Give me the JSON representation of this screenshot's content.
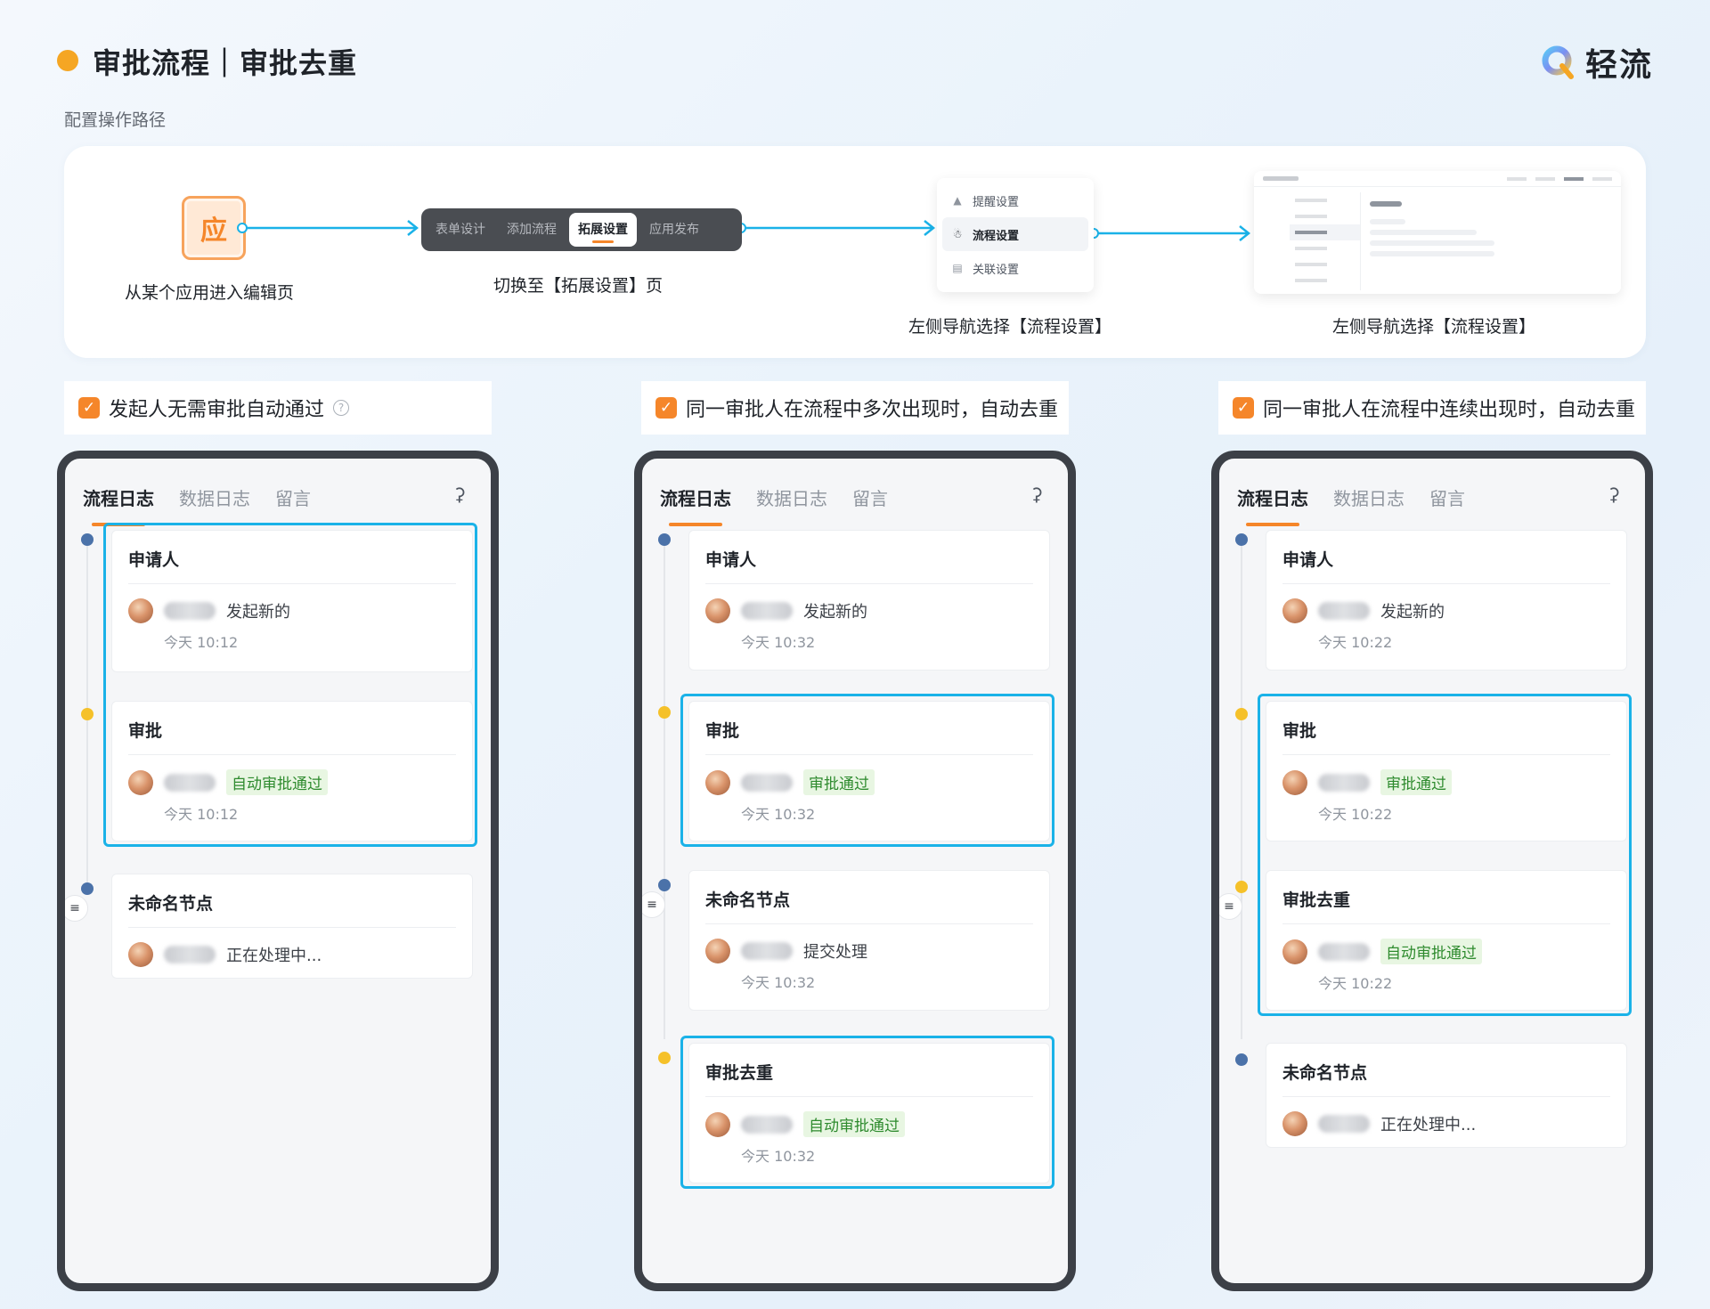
{
  "header": {
    "title": "审批流程｜审批去重",
    "brand_name": "轻流"
  },
  "path": {
    "label": "配置操作路径",
    "app_icon_char": "应",
    "step1_caption": "从某个应用进入编辑页",
    "tabs": [
      "表单设计",
      "添加流程",
      "拓展设置",
      "应用发布"
    ],
    "step2_caption": "切换至【拓展设置】页",
    "nav_items": [
      "提醒设置",
      "流程设置",
      "关联设置"
    ],
    "step3_caption": "左侧导航选择【流程设置】",
    "step4_caption": "左侧导航选择【流程设置】"
  },
  "options": [
    "发起人无需审批自动通过",
    "同一审批人在流程中多次出现时，自动去重",
    "同一审批人在流程中连续出现时，自动去重"
  ],
  "phone_tabs": [
    "流程日志",
    "数据日志",
    "留言"
  ],
  "phones": [
    {
      "nodes": [
        {
          "title": "申请人",
          "text": "发起新的",
          "badge": "",
          "time": "今天 10:12"
        },
        {
          "title": "审批",
          "text": "",
          "badge": "自动审批通过",
          "time": "今天 10:12"
        },
        {
          "title": "未命名节点",
          "text": "正在处理中...",
          "badge": "",
          "time": ""
        }
      ]
    },
    {
      "nodes": [
        {
          "title": "申请人",
          "text": "发起新的",
          "badge": "",
          "time": "今天 10:32"
        },
        {
          "title": "审批",
          "text": "",
          "badge": "审批通过",
          "time": "今天 10:32"
        },
        {
          "title": "未命名节点",
          "text": "提交处理",
          "badge": "",
          "time": "今天 10:32"
        },
        {
          "title": "审批去重",
          "text": "",
          "badge": "自动审批通过",
          "time": "今天 10:32"
        }
      ]
    },
    {
      "nodes": [
        {
          "title": "申请人",
          "text": "发起新的",
          "badge": "",
          "time": "今天 10:22"
        },
        {
          "title": "审批",
          "text": "",
          "badge": "审批通过",
          "time": "今天 10:22"
        },
        {
          "title": "审批去重",
          "text": "",
          "badge": "自动审批通过",
          "time": "今天 10:22"
        },
        {
          "title": "未命名节点",
          "text": "正在处理中...",
          "badge": "",
          "time": ""
        }
      ]
    }
  ],
  "colors": {
    "accent_orange": "#f5862a",
    "highlight_blue": "#1ab2e8",
    "badge_green": "#2e8b2e"
  }
}
